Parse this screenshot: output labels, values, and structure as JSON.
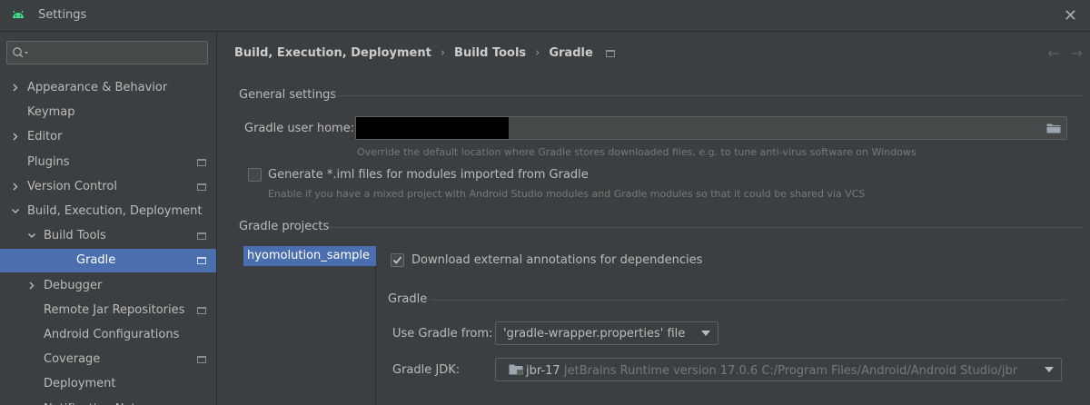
{
  "window": {
    "title": "Settings",
    "close_glyph": "✕",
    "app_icon": "android-icon"
  },
  "sidebar": {
    "search_placeholder": "",
    "items": [
      {
        "label": "Appearance & Behavior",
        "chevron": "right"
      },
      {
        "label": "Keymap"
      },
      {
        "label": "Editor",
        "chevron": "right"
      },
      {
        "label": "Plugins",
        "project_icon": true
      },
      {
        "label": "Version Control",
        "chevron": "right",
        "project_icon": true
      },
      {
        "label": "Build, Execution, Deployment",
        "chevron": "down"
      },
      {
        "label": "Build Tools",
        "chevron": "down",
        "project_icon": true
      },
      {
        "label": "Gradle",
        "selected": true,
        "project_icon": true
      },
      {
        "label": "Debugger",
        "chevron": "right"
      },
      {
        "label": "Remote Jar Repositories",
        "project_icon": true
      },
      {
        "label": "Android Configurations"
      },
      {
        "label": "Coverage",
        "project_icon": true
      },
      {
        "label": "Deployment"
      },
      {
        "label": "Notification Nat...",
        "project_icon": true
      }
    ]
  },
  "breadcrumb": {
    "items": [
      "Build, Execution, Deployment",
      "Build Tools",
      "Gradle"
    ],
    "separator": "›"
  },
  "nav": {
    "back": "←",
    "forward": "→"
  },
  "general": {
    "section_title": "General settings",
    "user_home_label": "Gradle user home:",
    "user_home_value": "",
    "user_home_hint": "Override the default location where Gradle stores downloaded files, e.g. to tune anti-virus software on Windows",
    "generate_iml_label": "Generate *.iml files for modules imported from Gradle",
    "generate_iml_checked": false,
    "generate_iml_hint": "Enable if you have a mixed project with Android Studio modules and Gradle modules so that it could be shared via VCS"
  },
  "projects": {
    "section_title": "Gradle projects",
    "items": [
      "hyomolution_sample"
    ],
    "download_annotations_label": "Download external annotations for dependencies",
    "download_annotations_checked": true,
    "gradle_section_title": "Gradle",
    "use_gradle_from_label": "Use Gradle from:",
    "use_gradle_from_value": "'gradle-wrapper.properties' file",
    "gradle_jdk_label": "Gradle JDK:",
    "gradle_jdk_name": "jbr-17",
    "gradle_jdk_detail": "JetBrains Runtime version 17.0.6 C:/Program Files/Android/Android Studio/jbr"
  },
  "colors": {
    "background": "#3c3f41",
    "selection": "#4b6eaf",
    "text": "#bbbbbb",
    "muted": "#787878"
  }
}
